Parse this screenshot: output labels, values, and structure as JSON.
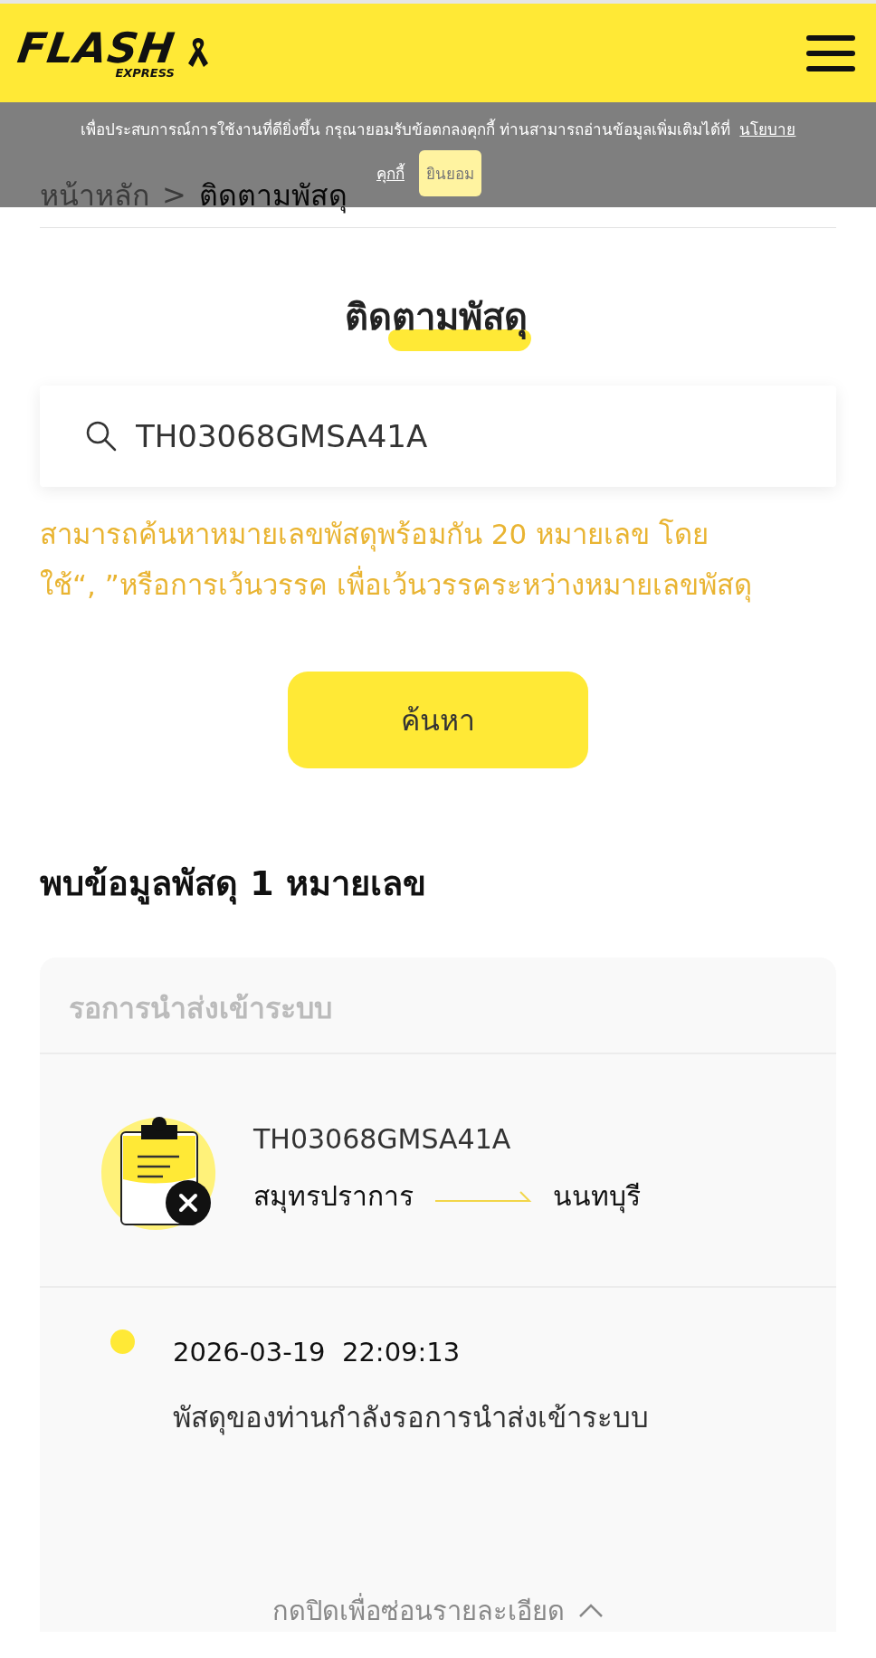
{
  "header": {
    "logo": {
      "word": "FLASH",
      "tagline": "EXPRESS"
    }
  },
  "cookie_banner": {
    "message": "เพื่อประสบการณ์การใช้งานที่ดียิ่งขึ้น  กรุณายอมรับข้อตกลงคุกกี้  ท่านสามารถอ่านข้อมูลเพิ่มเติมได้ที่",
    "link": [
      "นโยบาย",
      "คุกกี้"
    ],
    "accept_button": "ยินยอม"
  },
  "breadcrumb": {
    "separator": ">",
    "items": [
      {
        "label": "หน้าหลัก",
        "current": false
      },
      {
        "label": "ติดตามพัสดุ",
        "current": true
      }
    ]
  },
  "title": "ติดตามพัสดุ",
  "search": {
    "value": "TH03068GMSA41A"
  },
  "hint_lines": [
    "สามารถค้นหาหมายเลขพัสดุพร้อมกัน 20 หมายเลข โดย",
    "ใช้“, ”หรือการเว้นวรรค เพื่อเว้นวรรคระหว่างหมายเลขพัสดุ"
  ],
  "search_button": "ค้นหา",
  "result_count": "พบข้อมูลพัสดุ 1 หมายเลข",
  "parcels": [
    {
      "status": "รอการนำส่งเข้าระบบ",
      "tracking_number": "TH03068GMSA41A",
      "origin": "สมุทรปราการ",
      "destination": "นนทบุรี",
      "expanded": true,
      "toggle_label": "กดปิดเพื่อซ่อนรายละเอียด",
      "events": [
        {
          "time": "2026-03-19  22:09:13",
          "message": "พัสดุของท่านกำลังรอการนำส่งเข้าระบบ"
        }
      ]
    }
  ]
}
